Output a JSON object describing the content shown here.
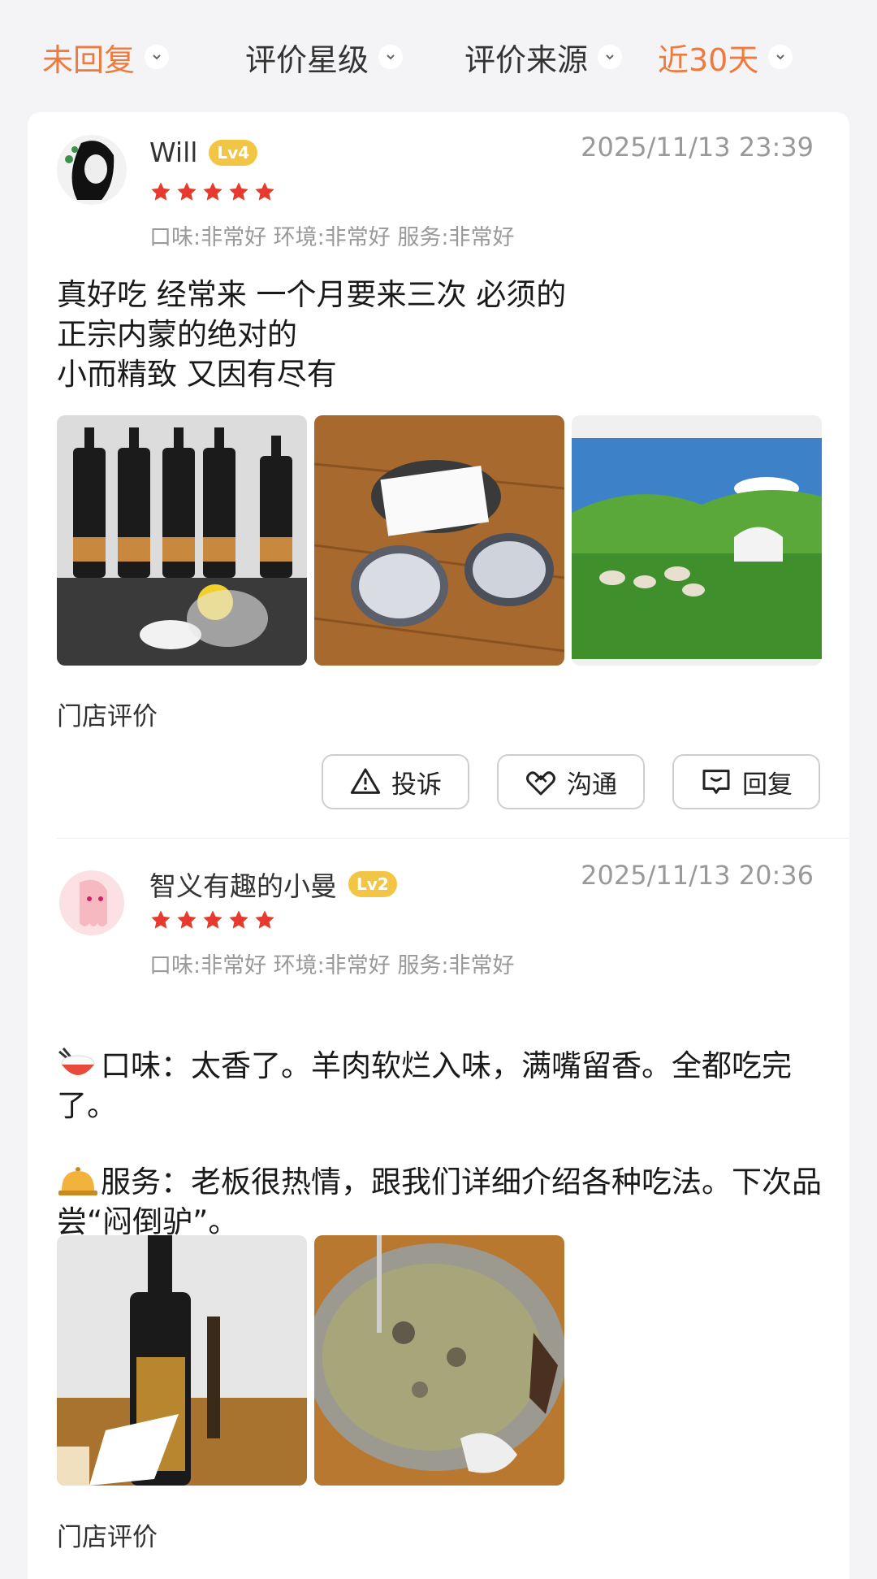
{
  "filters": [
    {
      "label": "未回复",
      "active": true
    },
    {
      "label": "评价星级",
      "active": false
    },
    {
      "label": "评价来源",
      "active": false
    },
    {
      "label": "近30天",
      "active": true
    }
  ],
  "reviews": [
    {
      "username": "Will",
      "level": "Lv4",
      "date": "2025/11/13 23:39",
      "rating": 5,
      "scores": "口味:非常好 环境:非常好 服务:非常好",
      "content": "真好吃 经常来 一个月要来三次 必须的\n正宗内蒙的绝对的\n小而精致 又因有尽有",
      "photos": [
        "liquor-bottles-photo",
        "table-sauce-photo",
        "grassland-mural-photo"
      ],
      "store_label": "门店评价",
      "actions": {
        "complain": "投诉",
        "communicate": "沟通",
        "reply": "回复"
      }
    },
    {
      "username": "智义有趣的小曼",
      "level": "Lv2",
      "date": "2025/11/13 20:36",
      "rating": 5,
      "scores": "口味:非常好 环境:非常好 服务:非常好",
      "content_taste": "口味：太香了。羊肉软烂入味，满嘴留香。全都吃完了。",
      "content_service": "服务：老板很热情，跟我们详细介绍各种吃法。下次品尝“闷倒驴”。",
      "photos": [
        "liquor-bottle-photo",
        "hotpot-photo"
      ],
      "store_label": "门店评价"
    }
  ],
  "colors": {
    "accent": "#ef7a3d",
    "star": "#e43a2f",
    "level_badge": "#f3c544"
  }
}
